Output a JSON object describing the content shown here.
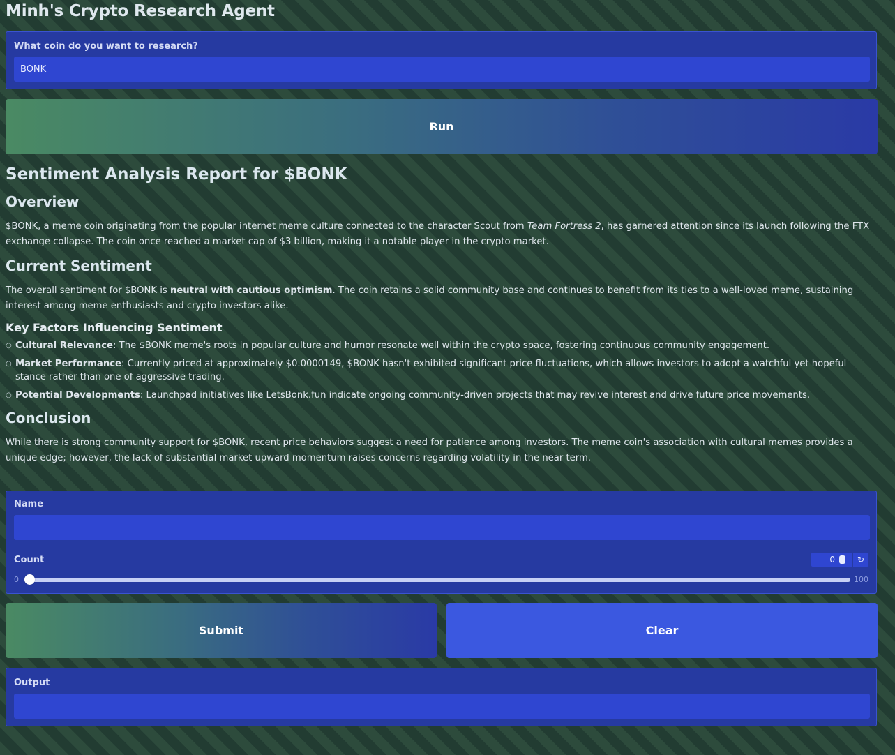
{
  "app": {
    "title": "Minh's Crypto Research Agent"
  },
  "research": {
    "label": "What coin do you want to research?",
    "value": "BONK",
    "run_label": "Run"
  },
  "report": {
    "title": "Sentiment Analysis Report for $BONK",
    "overview_heading": "Overview",
    "overview_text_1": "$BONK, a meme coin originating from the popular internet meme culture connected to the character Scout from ",
    "overview_text_em": "Team Fortress 2",
    "overview_text_2": ", has garnered attention since its launch following the FTX exchange collapse. The coin once reached a market cap of $3 billion, making it a notable player in the crypto market.",
    "sentiment_heading": "Current Sentiment",
    "sentiment_text_1": "The overall sentiment for $BONK is ",
    "sentiment_text_bold": "neutral with cautious optimism",
    "sentiment_text_2": ". The coin retains a solid community base and continues to benefit from its ties to a well-loved meme, sustaining interest among meme enthusiasts and crypto investors alike.",
    "factors_heading": "Key Factors Influencing Sentiment",
    "factors": [
      {
        "title": "Cultural Relevance",
        "text": ": The $BONK meme's roots in popular culture and humor resonate well within the crypto space, fostering continuous community engagement."
      },
      {
        "title": "Market Performance",
        "text": ": Currently priced at approximately $0.0000149, $BONK hasn't exhibited significant price fluctuations, which allows investors to adopt a watchful yet hopeful stance rather than one of aggressive trading."
      },
      {
        "title": "Potential Developments",
        "text": ": Launchpad initiatives like LetsBonk.fun indicate ongoing community-driven projects that may revive interest and drive future price movements."
      }
    ],
    "conclusion_heading": "Conclusion",
    "conclusion_text": "While there is strong community support for $BONK, recent price behaviors suggest a need for patience among investors. The meme coin's association with cultural memes provides a unique edge; however, the lack of substantial market upward momentum raises concerns regarding volatility in the near term."
  },
  "form": {
    "name_label": "Name",
    "name_value": "",
    "count_label": "Count",
    "count_value": "0",
    "slider_min": "0",
    "slider_max": "100",
    "slider_fraction": 0,
    "submit_label": "Submit",
    "clear_label": "Clear",
    "output_label": "Output",
    "output_value": ""
  },
  "icons": {
    "spinner": "spinner-arrows-icon",
    "reset": "reset-icon"
  },
  "colors": {
    "panel": "#263aa1",
    "input": "#2f46d1",
    "clear_button": "#3b58e0"
  }
}
